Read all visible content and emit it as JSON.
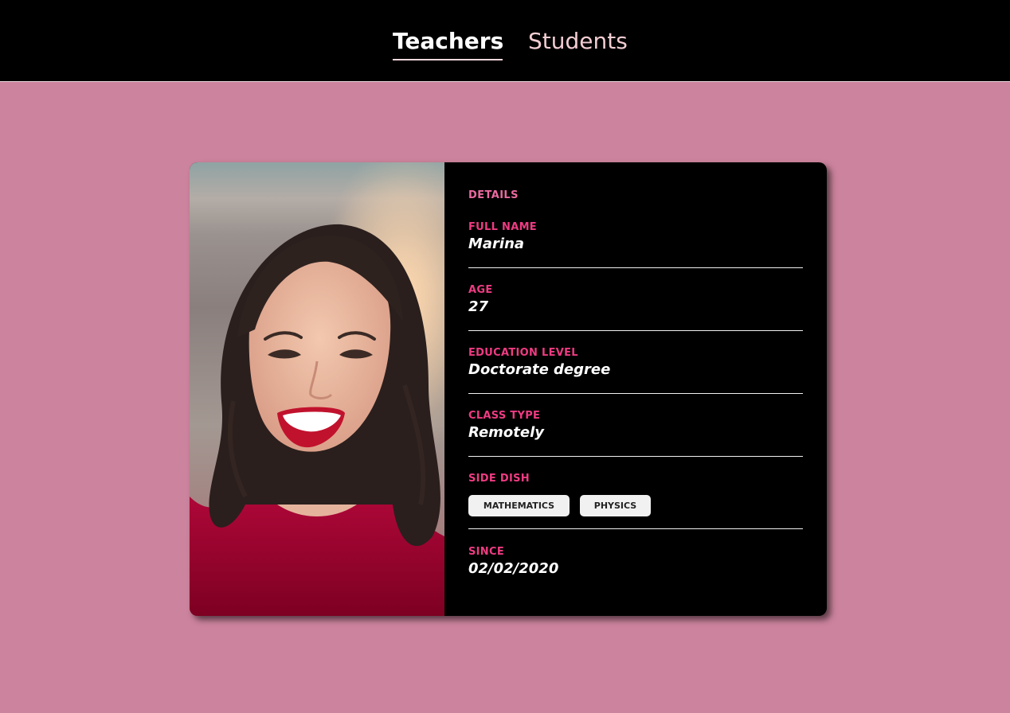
{
  "nav": {
    "tabs": [
      {
        "label": "Teachers"
      },
      {
        "label": "Students"
      }
    ]
  },
  "card": {
    "section_title": "DETAILS",
    "fields": {
      "full_name": {
        "label": "FULL NAME",
        "value": "Marina"
      },
      "age": {
        "label": "AGE",
        "value": "27"
      },
      "education": {
        "label": "EDUCATION LEVEL",
        "value": "Doctorate degree"
      },
      "class_type": {
        "label": "CLASS TYPE",
        "value": "Remotely"
      },
      "side_dish": {
        "label": "SIDE DISH",
        "tags": [
          "MATHEMATICS",
          "PHYSICS"
        ]
      },
      "since": {
        "label": "SINCE",
        "value": "02/02/2020"
      }
    }
  },
  "colors": {
    "page_background": "#cc839d",
    "accent_pink": "#ee3b82",
    "header_bg": "#000000",
    "chip_bg": "#f1f1f1"
  }
}
